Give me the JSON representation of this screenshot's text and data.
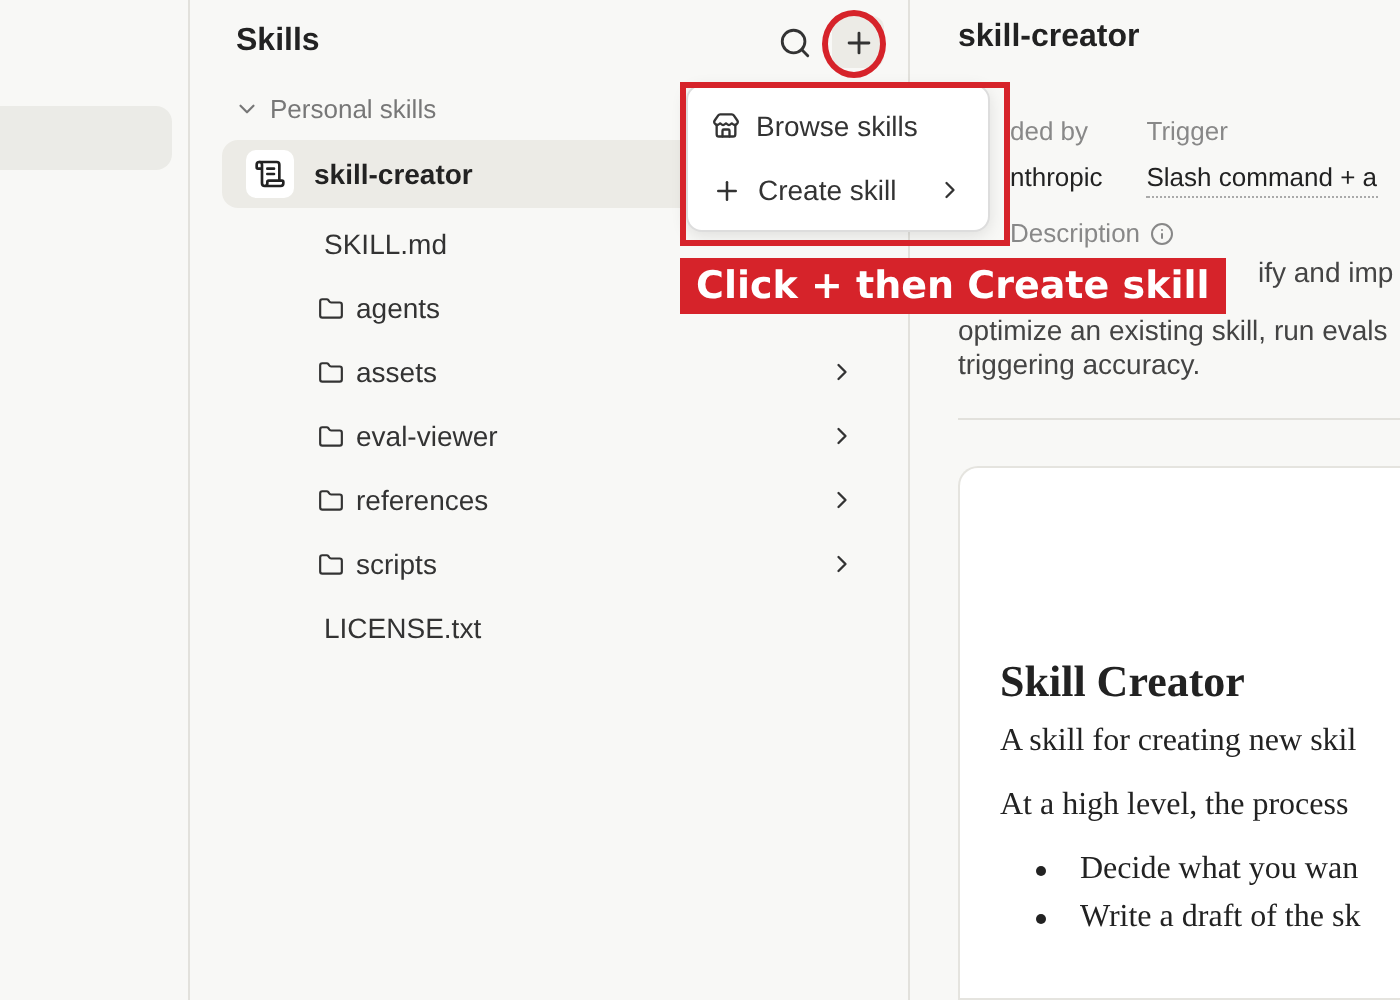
{
  "nav": {
    "items": [
      {
        "selected": true
      }
    ]
  },
  "skills_panel": {
    "title": "Skills",
    "section": {
      "label": "Personal skills",
      "expanded": true
    },
    "skill": {
      "name": "skill-creator",
      "selected": true,
      "children": [
        {
          "kind": "file",
          "name": "SKILL.md",
          "has_children": false
        },
        {
          "kind": "folder",
          "name": "agents",
          "has_children": false
        },
        {
          "kind": "folder",
          "name": "assets",
          "has_children": true
        },
        {
          "kind": "folder",
          "name": "eval-viewer",
          "has_children": true
        },
        {
          "kind": "folder",
          "name": "references",
          "has_children": true
        },
        {
          "kind": "folder",
          "name": "scripts",
          "has_children": true
        },
        {
          "kind": "file",
          "name": "LICENSE.txt",
          "has_children": false
        }
      ]
    }
  },
  "add_menu": {
    "items": [
      {
        "label": "Browse skills",
        "submenu": false
      },
      {
        "label": "Create skill",
        "submenu": true
      }
    ]
  },
  "annotation": {
    "text": "Click + then Create skill"
  },
  "detail": {
    "title": "skill-creator",
    "meta": [
      {
        "label": "ded by",
        "value": "nthropic",
        "dotted": false
      },
      {
        "label": "Trigger",
        "value": "Slash command + a",
        "dotted": true
      }
    ],
    "description_label": "Description",
    "description_lines": [
      "ify and imp",
      "optimize an existing skill, run evals",
      "triggering accuracy."
    ],
    "document": {
      "heading": "Skill Creator",
      "paragraphs": [
        "A skill for creating new skil",
        "At a high level, the process"
      ],
      "bullets": [
        "Decide what you wan",
        "Write a draft of the sk"
      ]
    }
  }
}
